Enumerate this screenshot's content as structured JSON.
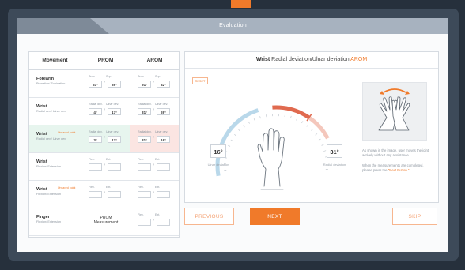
{
  "window": {
    "title": "Evaluation"
  },
  "table": {
    "headers": {
      "movement": "Movement",
      "prom": "PROM",
      "arom": "AROM"
    },
    "rows": [
      {
        "name": "Forearm",
        "sub": "Pronation/ Supination",
        "flag": "",
        "prom": {
          "l1": "Pron.",
          "l2": "Sup.",
          "v1": "61°",
          "v2": "39°"
        },
        "arom": {
          "l1": "Pron.",
          "l2": "Sup.",
          "v1": "91°",
          "v2": "32°"
        }
      },
      {
        "name": "Wrist",
        "sub": "Radial dev./ Ulnar dev.",
        "flag": "",
        "prom": {
          "l1": "Radial dev.",
          "l2": "Ulnar dev.",
          "v1": "4°",
          "v2": "17°"
        },
        "arom": {
          "l1": "Radial dev.",
          "l2": "Ulnar dev.",
          "v1": "31°",
          "v2": "26°"
        }
      },
      {
        "name": "Wrist",
        "sub": "Radial dev./ Ulnar dev.",
        "flag": "Unsaved point",
        "prom": {
          "l1": "Radial dev.",
          "l2": "Ulnar dev.",
          "v1": "3°",
          "v2": "17°"
        },
        "arom": {
          "l1": "Radial dev.",
          "l2": "Ulnar dev.",
          "v1": "31°",
          "v2": "16°"
        }
      },
      {
        "name": "Wrist",
        "sub": "Flexion/ Extension",
        "flag": "",
        "prom": {
          "l1": "Flex.",
          "l2": "Ext.",
          "v1": "",
          "v2": ""
        },
        "arom": {
          "l1": "Flex.",
          "l2": "Ext.",
          "v1": "",
          "v2": ""
        }
      },
      {
        "name": "Wrist",
        "sub": "Flexion/ Extension",
        "flag": "Unsaved point",
        "prom": {
          "l1": "Flex.",
          "l2": "Ext.",
          "v1": "",
          "v2": ""
        },
        "arom": {
          "l1": "Flex.",
          "l2": "Ext.",
          "v1": "",
          "v2": ""
        }
      },
      {
        "name": "Finger",
        "sub": "Flexion/ Extension",
        "flag": "",
        "prom_measurement": "PROM Measurement",
        "arom": {
          "l1": "Flex.",
          "l2": "Ext.",
          "v1": "",
          "v2": ""
        }
      }
    ]
  },
  "detail": {
    "title_bold": "Wrist",
    "title_normal": "Radial deviation/Ulnar deviation",
    "title_accent": "AROM",
    "reset_label": "RESET",
    "gauge": {
      "ulnar_value": 16,
      "radial_value": 31,
      "range_max": 90
    },
    "ulnar_display": "16°",
    "radial_display": "31°",
    "ulnar_label": "Ulnar deviation",
    "radial_label": "Radial deviation",
    "instructions": {
      "p1": "As shown in the image, user moves the joint actively without any assistance.",
      "p2_a": "When the measurements are completed, please press the",
      "p2_b": "\"Next Button.\""
    }
  },
  "buttons": {
    "previous": "PREVIOUS",
    "next": "NEXT",
    "skip": "SKIP"
  },
  "colors": {
    "accent": "#f07a2a",
    "gauge_blue": "#b9d8ea",
    "gauge_red": "#e06a4f"
  }
}
